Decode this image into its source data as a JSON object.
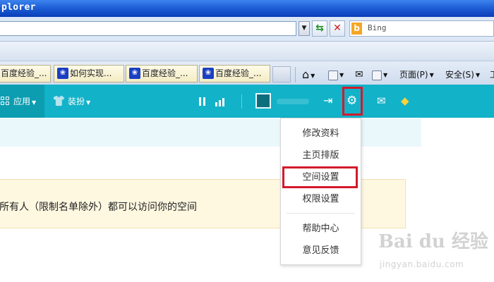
{
  "window": {
    "title": "plorer"
  },
  "address_bar": {
    "value": ""
  },
  "search": {
    "placeholder": "Bing"
  },
  "tabs": [
    {
      "label": "百度经验_..."
    },
    {
      "label": "如何实现..."
    },
    {
      "label": "百度经验_..."
    },
    {
      "label": "百度经验_..."
    }
  ],
  "command_bar": {
    "page_label": "页面(P)",
    "safety_label": "安全(S)"
  },
  "site_nav": {
    "apps_label": "应用",
    "dressup_label": "装扮"
  },
  "notice": {
    "text": "所有人（限制名单除外）都可以访问你的空间"
  },
  "settings_menu": {
    "items": [
      "修改资料",
      "主页排版",
      "空间设置",
      "权限设置",
      "帮助中心",
      "意见反馈"
    ],
    "highlighted": "空间设置"
  },
  "watermark": {
    "brand": "Bai du 经验",
    "url": "jingyan.baidu.com"
  },
  "colors": {
    "nav_teal": "#12b2c8",
    "highlight_red": "#d31a2d",
    "notice_bg": "#fff8e1"
  },
  "icons": [
    "refresh-icon",
    "stop-icon",
    "bing-icon",
    "home-icon",
    "rss-icon",
    "mail-icon",
    "print-icon",
    "apps-grid-icon",
    "tshirt-icon",
    "pause-icon",
    "stats-bars-icon",
    "logout-icon",
    "gear-icon",
    "envelope-icon",
    "diamond-icon"
  ]
}
